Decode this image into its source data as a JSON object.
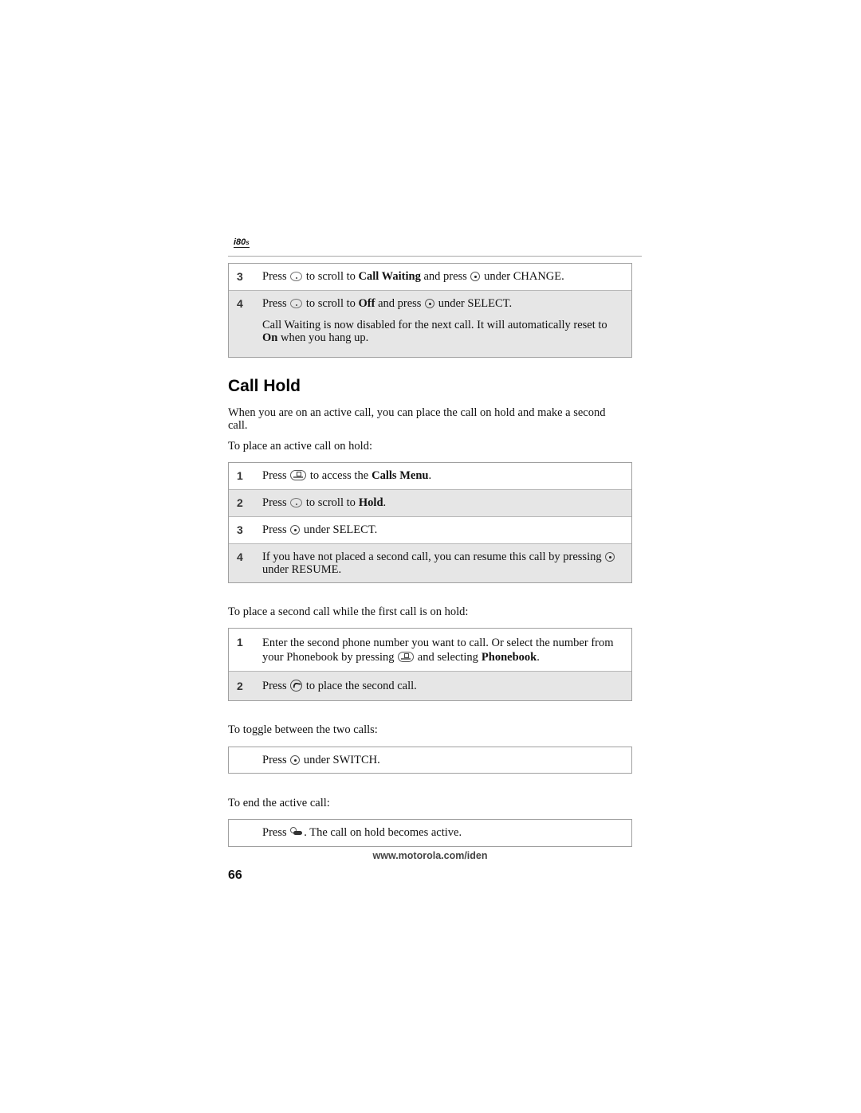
{
  "header": {
    "logo_main": "i80",
    "logo_suffix": "s"
  },
  "call_waiting_steps": [
    {
      "num": "3",
      "pre": "Press",
      "icon": "nav-key",
      "mid": "to scroll to",
      "bold": "Call Waiting",
      "mid2": "and press",
      "icon2": "select-key",
      "post": "under CHANGE."
    },
    {
      "num": "4",
      "pre": "Press",
      "icon": "nav-key",
      "mid": "to scroll to",
      "bold": "Off",
      "mid2": "and press",
      "icon2": "select-key",
      "post": "under SELECT.",
      "note_pre": "Call Waiting is now disabled for the next call. It will automatically reset to",
      "note_bold": "On",
      "note_post": "when you hang up."
    }
  ],
  "section": {
    "title": "Call Hold",
    "intro": "When you are on an active call, you can place the call on hold and make a second call.",
    "hold_lead": "To place an active call on hold:",
    "hold_steps": [
      {
        "num": "1",
        "pre": "Press",
        "icon": "menu-key",
        "mid": "to access the",
        "bold": "Calls Menu",
        "post": "."
      },
      {
        "num": "2",
        "pre": "Press",
        "icon": "nav-key",
        "mid": "to scroll to",
        "bold": "Hold",
        "post": "."
      },
      {
        "num": "3",
        "pre": "Press",
        "icon": "select-key",
        "post": "under SELECT."
      },
      {
        "num": "4",
        "pre": "If you have not placed a second call, you can resume this call by pressing",
        "icon": "select-key",
        "post": "under RESUME."
      }
    ],
    "second_lead": "To place a second call while the first call is on hold:",
    "second_steps": [
      {
        "num": "1",
        "pre": "Enter the second phone number you want to call. Or select the number from your Phonebook by pressing",
        "icon": "menu-key",
        "mid": "and selecting",
        "bold": "Phonebook",
        "post": "."
      },
      {
        "num": "2",
        "pre": "Press",
        "icon": "send-key",
        "post": "to place the second call."
      }
    ],
    "toggle_lead": "To toggle between the two calls:",
    "toggle_step": {
      "pre": "Press",
      "icon": "select-key",
      "post": "under SWITCH."
    },
    "end_lead": "To end the active call:",
    "end_step": {
      "pre": "Press",
      "icon": "end-key",
      "post": ". The call on hold becomes active."
    }
  },
  "footer": {
    "url": "www.motorola.com/iden",
    "page_number": "66"
  }
}
